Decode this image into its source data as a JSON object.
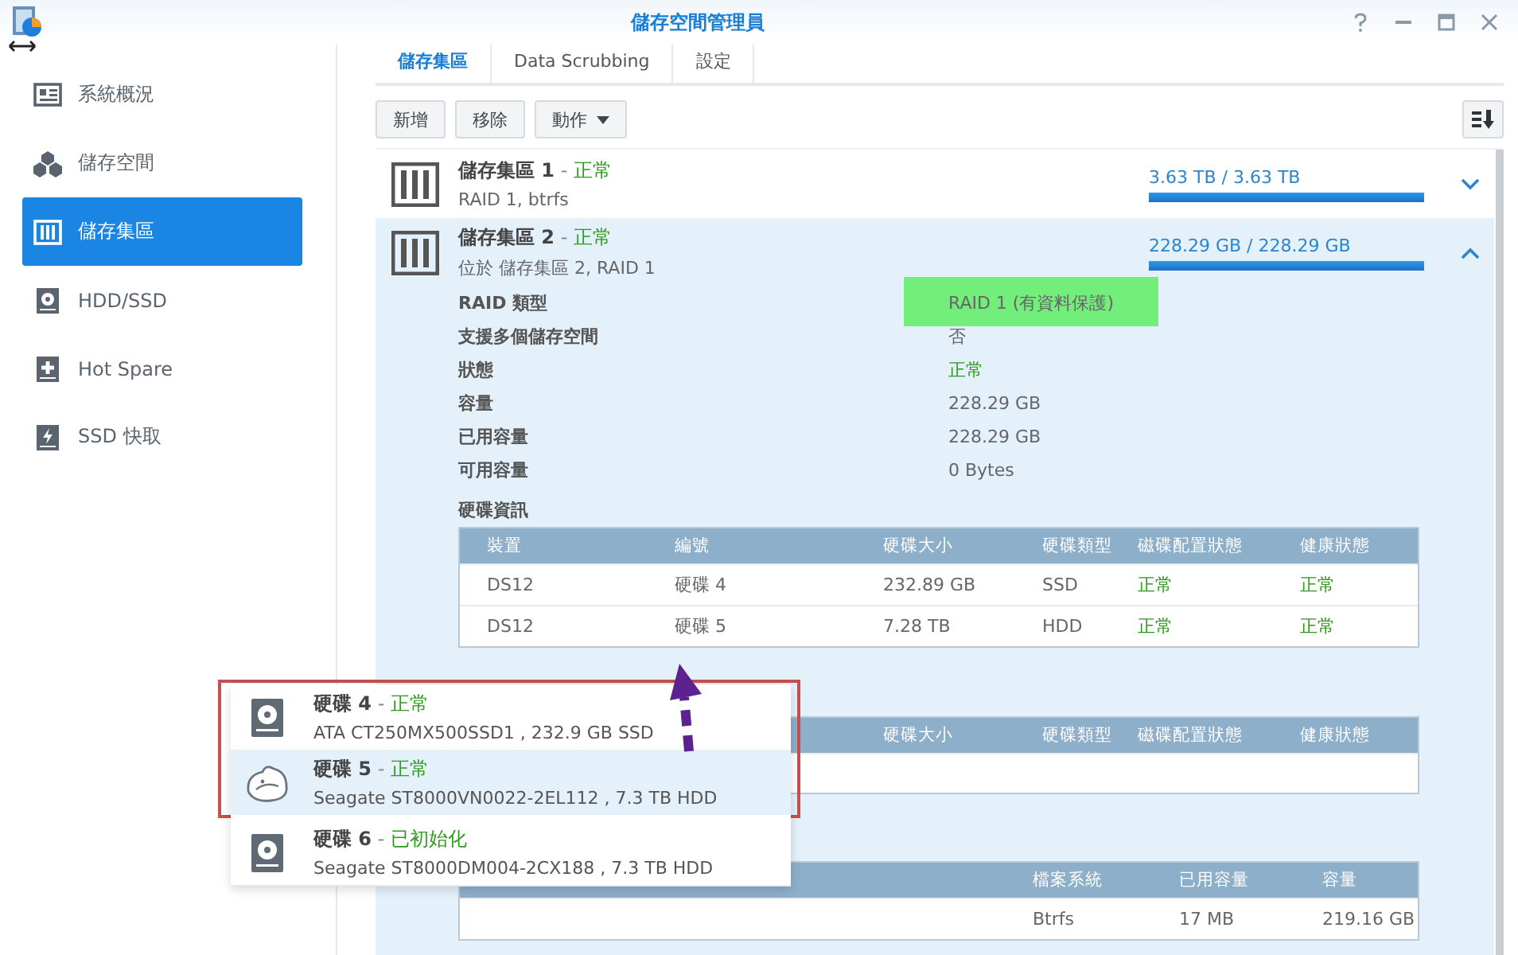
{
  "window": {
    "title": "儲存空間管理員"
  },
  "sidebar": {
    "items": [
      {
        "label": "系統概況",
        "selected": false
      },
      {
        "label": "儲存空間",
        "selected": false
      },
      {
        "label": "儲存集區",
        "selected": true
      },
      {
        "label": "HDD/SSD",
        "selected": false
      },
      {
        "label": "Hot Spare",
        "selected": false
      },
      {
        "label": "SSD 快取",
        "selected": false
      }
    ]
  },
  "tabs": [
    {
      "label": "儲存集區",
      "selected": true
    },
    {
      "label": "Data Scrubbing",
      "selected": false
    },
    {
      "label": "設定",
      "selected": false
    }
  ],
  "toolbar": {
    "buttons": [
      {
        "label": "新增",
        "dropdown": false
      },
      {
        "label": "移除",
        "dropdown": false
      },
      {
        "label": "動作",
        "dropdown": true
      }
    ]
  },
  "pools": [
    {
      "name": "儲存集區 1",
      "separator": "-",
      "status": "正常",
      "subtitle": "RAID 1, btrfs",
      "usage": "3.63 TB / 3.63 TB",
      "level": 1,
      "expanded": false
    },
    {
      "name": "儲存集區 2",
      "separator": "-",
      "status": "正常",
      "subtitle": "位於 儲存集區 2, RAID 1",
      "usage": "228.29 GB / 228.29 GB",
      "level": 1,
      "expanded": true,
      "details": [
        {
          "label": "RAID 類型",
          "value": "RAID 1 (有資料保護)",
          "kind": "plain",
          "highlighted": true
        },
        {
          "label": "支援多個儲存空間",
          "value": "否",
          "kind": "plain",
          "highlighted": false
        },
        {
          "label": "狀態",
          "value": "正常",
          "kind": "status",
          "highlighted": false
        },
        {
          "label": "容量",
          "value": "228.29 GB",
          "kind": "plain",
          "highlighted": false
        },
        {
          "label": "已用容量",
          "value": "228.29 GB",
          "kind": "plain",
          "highlighted": false
        },
        {
          "label": "可用容量",
          "value": "0 Bytes",
          "kind": "plain",
          "highlighted": false
        }
      ],
      "disk_section_title": "硬碟資訊",
      "disk_table": {
        "columns": [
          {
            "label": "裝置",
            "kind": "plain"
          },
          {
            "label": "編號",
            "kind": "plain"
          },
          {
            "label": "硬碟大小",
            "kind": "plain"
          },
          {
            "label": "硬碟類型",
            "kind": "plain"
          },
          {
            "label": "磁碟配置狀態",
            "kind": "status"
          },
          {
            "label": "健康狀態",
            "kind": "status"
          }
        ],
        "rows": [
          [
            "DS12",
            "硬碟 4",
            "232.89 GB",
            "SSD",
            "正常",
            "正常"
          ],
          [
            "DS12",
            "硬碟 5",
            "7.28 TB",
            "HDD",
            "正常",
            "正常"
          ]
        ]
      },
      "table_2": {
        "columns": [
          "硬碟大小",
          "硬碟類型",
          "磁碟配置狀態",
          "健康狀態"
        ]
      },
      "table_3": {
        "columns": [
          "檔案系統",
          "已用容量",
          "容量"
        ],
        "rows": [
          [
            "Btrfs",
            "17 MB",
            "219.16 GB"
          ]
        ]
      }
    }
  ],
  "disk_popup": {
    "items": [
      {
        "name": "硬碟 4",
        "separator": "-",
        "status": "正常",
        "detail": "ATA CT250MX500SSD1 , 232.9 GB SSD",
        "selected": false
      },
      {
        "name": "硬碟 5",
        "separator": "-",
        "status": "正常",
        "detail": "Seagate ST8000VN0022-2EL112 , 7.3 TB HDD",
        "selected": true
      },
      {
        "name": "硬碟 6",
        "separator": "-",
        "status": "已初始化",
        "detail": "Seagate ST8000DM004-2CX188 , 7.3 TB HDD",
        "selected": false
      }
    ]
  },
  "annotations": {
    "frame": true,
    "arrow": true
  }
}
